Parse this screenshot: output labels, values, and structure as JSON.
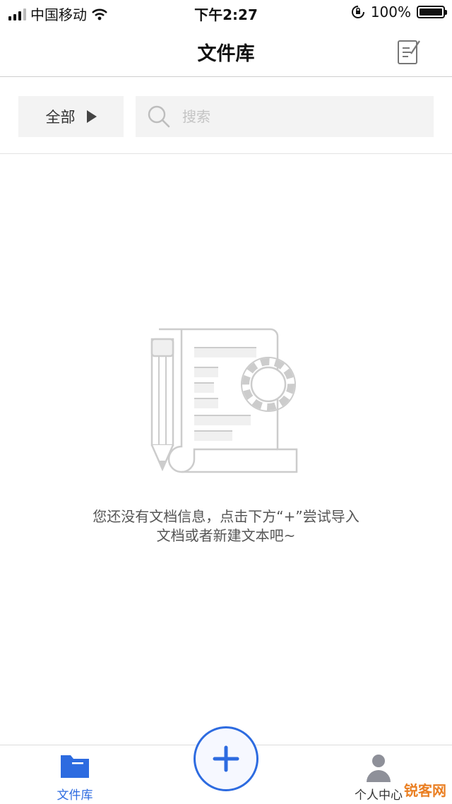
{
  "status_bar": {
    "carrier": "中国移动",
    "time": "下午2:27",
    "battery": "100%"
  },
  "nav": {
    "title": "文件库"
  },
  "filter": {
    "all_label": "全部",
    "search_placeholder": "搜索"
  },
  "empty_state": {
    "line1": "您还没有文档信息，点击下方“+”尝试导入",
    "line2": "文档或者新建文本吧~"
  },
  "tab_bar": {
    "library_label": "文件库",
    "profile_label": "个人中心"
  },
  "watermark": "锐客网",
  "colors": {
    "accent": "#2d6be0",
    "muted_text": "#555555",
    "placeholder": "#c4c4c4",
    "field_bg": "#f3f3f3"
  },
  "icons": [
    "signal-icon",
    "wifi-icon",
    "rotation-lock-icon",
    "battery-icon",
    "edit-note-icon",
    "play-icon",
    "search-icon",
    "document-gear-illustration",
    "folder-icon",
    "plus-icon",
    "person-icon"
  ]
}
